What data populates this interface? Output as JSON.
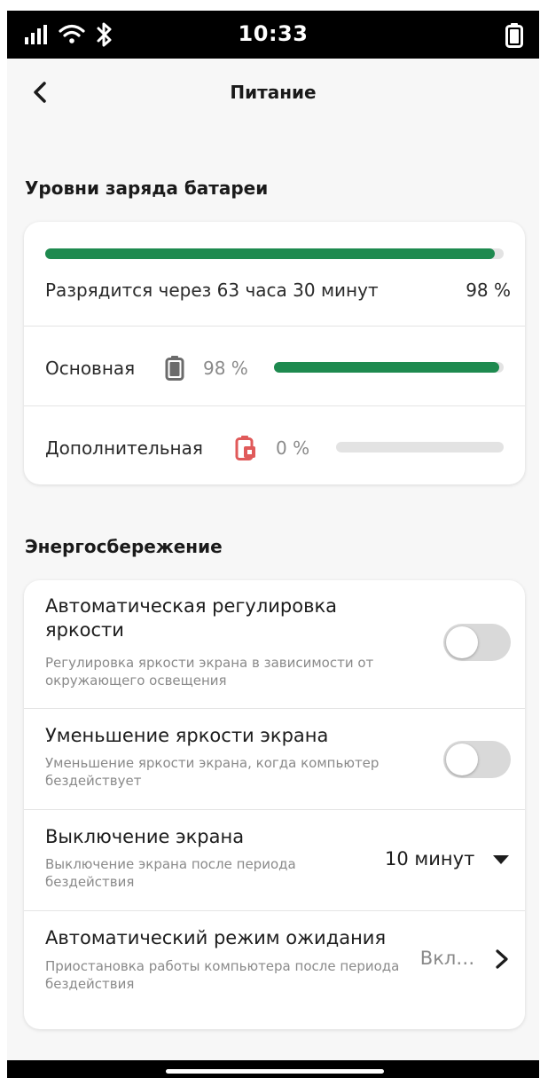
{
  "status_bar": {
    "time": "10:33",
    "icons": [
      "signal-icon",
      "wifi-icon",
      "bluetooth-icon",
      "battery-icon"
    ]
  },
  "header": {
    "title": "Питание",
    "back_icon": "chevron-left-icon"
  },
  "battery_section": {
    "title": "Уровни заряда батареи",
    "total": {
      "fill_fraction": 0.98,
      "text": "Разрядится через 63 часа 30 минут",
      "percent": "98 %"
    },
    "primary": {
      "label": "Основная",
      "percent": "98 %",
      "fill_fraction": 0.98,
      "icon": "battery-icon"
    },
    "secondary": {
      "label": "Дополнительная",
      "percent": "0 %",
      "fill_fraction": 0.0,
      "icon": "battery-locked-icon"
    },
    "colors": {
      "fill": "#1e8a4f",
      "track": "#e3e3e3",
      "warning_icon": "#e05a5a"
    }
  },
  "energy_section": {
    "title": "Энергосбережение",
    "items": [
      {
        "title": "Автоматическая регулировка яркости",
        "description": "Регулировка яркости экрана в зависимости от окружающего освещения",
        "control": "toggle",
        "enabled": false
      },
      {
        "title": "Уменьшение яркости экрана",
        "description": "Уменьшение яркости экрана, когда компьютер бездействует",
        "control": "toggle",
        "enabled": false
      },
      {
        "title": "Выключение экрана",
        "description": "Выключение экрана после периода бездействия",
        "control": "dropdown",
        "value": "10 минут"
      },
      {
        "title": "Автоматический режим ожидания",
        "description": "Приостановка работы компьютера после периода бездействия",
        "control": "link",
        "value": "Вкл…"
      }
    ]
  }
}
